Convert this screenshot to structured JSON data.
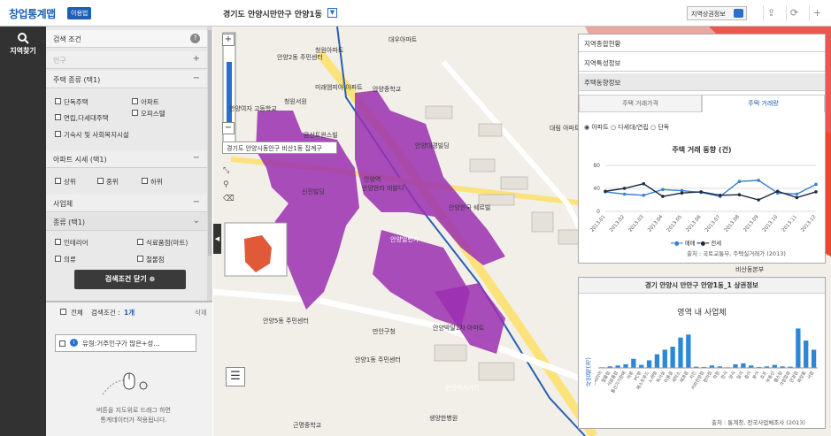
{
  "app": {
    "logo": "창업통계맵",
    "badge": "이용법"
  },
  "topbar": {
    "location": "경기도 안양시만안구 안양1동",
    "shop_info": "지역상권정보",
    "icons": [
      "upload-icon",
      "refresh-icon",
      "plus-icon"
    ]
  },
  "nav": {
    "search_label": "지역찾기"
  },
  "filter": {
    "title": "검색 조건",
    "help": "?",
    "population": "인구",
    "housing_type": "주택 종류 (택1)",
    "housing_options": [
      "단독주택",
      "아파트",
      "연립,다세대주택",
      "오피스텔",
      "기숙사 및 사회복지시설"
    ],
    "apt_price": "아파트 시세 (택1)",
    "apt_price_options": [
      "상위",
      "중위",
      "하위"
    ],
    "business": "사업체",
    "kind": "종류 (택1)",
    "kind_options": [
      "인테리어",
      "식료품점(마트)",
      "의류",
      "철물점"
    ],
    "close_button": "검색조건 닫기"
  },
  "results": {
    "all_label": "전체",
    "count_label": "검색조건 :",
    "count_value": "1개",
    "delete": "삭제",
    "item": "유형:거주인구가 많은+성…",
    "hint1": "버튼을 지도위로 드래그 하면",
    "hint2": "통계데이터가 적용됩니다."
  },
  "map": {
    "zoom_in": "+",
    "zoom_out": "−",
    "tooltip": "경기도 안양시동안구 비산1동 집계구",
    "labels": [
      "대우아파트",
      "청원아파트",
      "안양2동 주민센터",
      "미래엠피아 아파트",
      "안양중학교",
      "안양여자 고등학교",
      "청원서원",
      "금산트윈스빌",
      "신진빌딩",
      "안양역",
      "안양대경빌딩",
      "안양한라 비발디",
      "안양일번가",
      "안양5동 주민센터",
      "안양한국 쉐르빌",
      "만안구청",
      "안양박달1차 아파트",
      "안양1동 주민센터",
      "근명중학교",
      "안양역사거리",
      "생양한병원",
      "비산동본부",
      "대림 아파트"
    ]
  },
  "region_panel": {
    "tabs": [
      "지역종합현황",
      "지역특성정보",
      "주택동향정보"
    ],
    "subtabs": [
      "주택 거래가격",
      "주택 거래량"
    ],
    "radios": [
      "아파트",
      "다세대/연립",
      "단독"
    ],
    "chart_title": "주택 거래 동향 (건)",
    "legend": [
      "매매",
      "전세"
    ],
    "source": "출처 : 국토교통부, 주택실거래가 (2013)"
  },
  "biz_panel": {
    "header": "경기 안양시 만안구 안양1동_1 상권정보",
    "chart_title": "영역 내 사업체",
    "ylabel": "사업체(개)",
    "source": "출처 : 통계청, 전국사업체조사 (2013)"
  },
  "chart_data": [
    {
      "type": "line",
      "title": "주택 거래 동향 (건)",
      "categories": [
        "2013.01",
        "2013.02",
        "2013.03",
        "2013.04",
        "2013.05",
        "2013.06",
        "2013.07",
        "2013.08",
        "2013.09",
        "2013.10",
        "2013.11",
        "2013.12"
      ],
      "ylim": [
        0,
        80
      ],
      "yticks": [
        0,
        40,
        80
      ],
      "series": [
        {
          "name": "매매",
          "color": "#3a7fd0",
          "values": [
            34,
            30,
            28,
            38,
            36,
            33,
            26,
            52,
            54,
            32,
            30,
            47
          ]
        },
        {
          "name": "전세",
          "color": "#1b2a44",
          "values": [
            35,
            40,
            48,
            26,
            32,
            34,
            28,
            29,
            20,
            35,
            24,
            34
          ]
        }
      ]
    },
    {
      "type": "bar",
      "title": "영역 내 사업체",
      "ylabel": "사업체(개)",
      "color": "#2e86d6",
      "categories": [
        "인테리어",
        "철물점",
        "식료품점",
        "통신기기판매",
        "의류",
        "PC방",
        "패스트푸드",
        "노래방",
        "독서실",
        "미용실",
        "세탁소",
        "제과점",
        "치킨",
        "커피전문점",
        "편의점",
        "학원",
        "한식",
        "양식",
        "일식",
        "중식",
        "분식",
        "호프",
        "부동산",
        "헬스장",
        "가방잡화",
        "안경점",
        "화장품",
        "서점",
        "문구점",
        "꽃집",
        "세차장",
        "기타"
      ],
      "values": [
        2,
        5,
        8,
        12,
        30,
        10,
        25,
        45,
        60,
        70,
        100,
        110,
        4,
        3,
        8,
        5,
        2,
        12,
        15,
        8,
        3,
        5,
        10,
        5,
        4,
        130,
        90,
        60
      ]
    }
  ]
}
